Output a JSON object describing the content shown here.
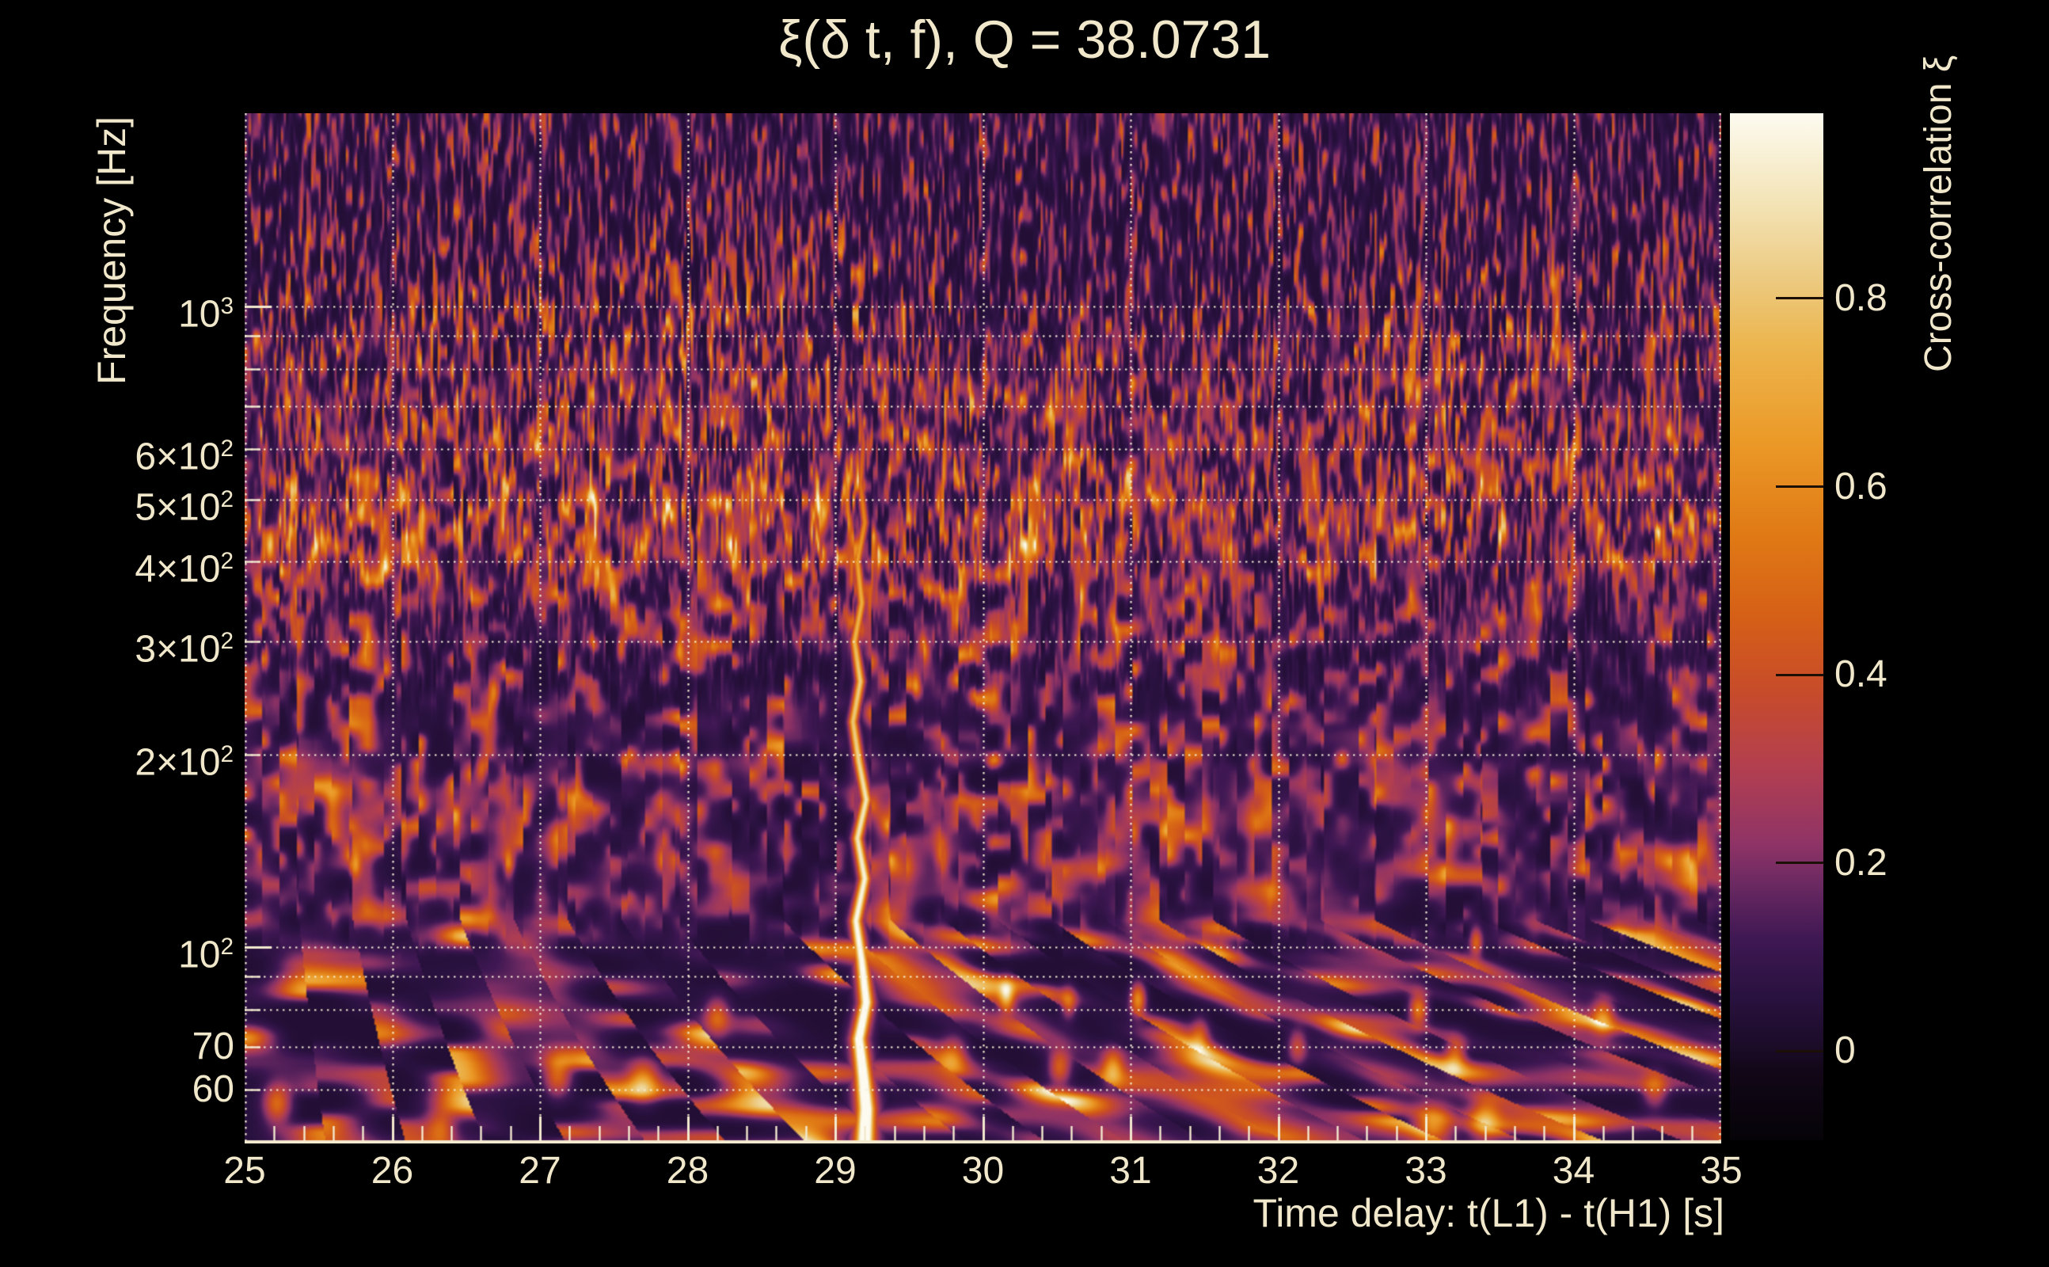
{
  "title": "ξ(δ t, f), Q = 38.0731",
  "q_value": 38.0731,
  "x_axis": {
    "label": "Time delay: t(L1) - t(H1) [s]",
    "min": 25,
    "max": 35,
    "minor_step": 0.2,
    "ticks": [
      25,
      26,
      27,
      28,
      29,
      30,
      31,
      32,
      33,
      34,
      35
    ]
  },
  "y_axis": {
    "label": "Frequency [Hz]",
    "scale": "log",
    "min": 50,
    "max": 2005,
    "ticks": [
      {
        "f": 1000,
        "label": "10^3"
      },
      {
        "f": 600,
        "label": "6×10^2"
      },
      {
        "f": 500,
        "label": "5×10^2"
      },
      {
        "f": 400,
        "label": "4×10^2"
      },
      {
        "f": 300,
        "label": "3×10^2"
      },
      {
        "f": 200,
        "label": "2×10^2"
      },
      {
        "f": 100,
        "label": "10^2"
      },
      {
        "f": 70,
        "label": "70"
      },
      {
        "f": 60,
        "label": "60"
      }
    ],
    "gridline_freqs": [
      60,
      70,
      80,
      90,
      100,
      200,
      300,
      400,
      500,
      600,
      700,
      800,
      900,
      1000
    ]
  },
  "colorbar": {
    "label": "Cross-correlation ξ",
    "vmin": -0.095,
    "vmax": 0.997,
    "ticks": [
      {
        "value": 0,
        "label": "0"
      },
      {
        "value": 0.2,
        "label": "0.2"
      },
      {
        "value": 0.4,
        "label": "0.4"
      },
      {
        "value": 0.6,
        "label": "0.6"
      },
      {
        "value": 0.8,
        "label": "0.8"
      }
    ]
  },
  "colors": {
    "background": "#000000",
    "text": "#f1e8cb",
    "grid": "#f6efd7",
    "axis": "#f2e9ce",
    "colorbar_tick": "#1c0f06",
    "colormap_stops": [
      [
        -0.095,
        "#060308"
      ],
      [
        -0.02,
        "#120718"
      ],
      [
        0.0,
        "#1a0b26"
      ],
      [
        0.06,
        "#2a1240"
      ],
      [
        0.12,
        "#3f1853"
      ],
      [
        0.18,
        "#6d2a62"
      ],
      [
        0.22,
        "#8f3366"
      ],
      [
        0.3,
        "#b23f50"
      ],
      [
        0.38,
        "#c74b2b"
      ],
      [
        0.46,
        "#d55f17"
      ],
      [
        0.55,
        "#e07a15"
      ],
      [
        0.65,
        "#eb9a28"
      ],
      [
        0.75,
        "#ecb54e"
      ],
      [
        0.82,
        "#ecca80"
      ],
      [
        0.9,
        "#f3e3b5"
      ],
      [
        0.997,
        "#fdfbf0"
      ]
    ]
  },
  "chart_data": {
    "type": "heatmap",
    "subtype": "q-transform cross-correlation spectrogram",
    "title": "ξ(δ t, f), Q = 38.0731",
    "xlabel": "Time delay: t(L1) - t(H1) [s]",
    "ylabel": "Frequency [Hz]",
    "zlabel": "Cross-correlation ξ",
    "x_range": [
      25,
      35
    ],
    "y_range_hz": [
      50,
      2005
    ],
    "z_range": [
      -0.095,
      0.997
    ],
    "grid": "dotted cream gridlines at integer seconds and log-decade frequencies",
    "noise_floor": 0.035,
    "chirp_track": [
      [
        50,
        29.2,
        0.99,
        0.055
      ],
      [
        56,
        29.21,
        0.97,
        0.05
      ],
      [
        63,
        29.19,
        0.93,
        0.046
      ],
      [
        72,
        29.16,
        0.88,
        0.042
      ],
      [
        82,
        29.21,
        0.85,
        0.04
      ],
      [
        95,
        29.18,
        0.8,
        0.037
      ],
      [
        110,
        29.14,
        0.76,
        0.034
      ],
      [
        128,
        29.2,
        0.74,
        0.032
      ],
      [
        148,
        29.15,
        0.7,
        0.03
      ],
      [
        170,
        29.21,
        0.7,
        0.029
      ],
      [
        195,
        29.16,
        0.66,
        0.028
      ],
      [
        225,
        29.12,
        0.62,
        0.027
      ],
      [
        260,
        29.17,
        0.64,
        0.026
      ],
      [
        300,
        29.13,
        0.58,
        0.025
      ],
      [
        345,
        29.18,
        0.56,
        0.024
      ],
      [
        400,
        29.15,
        0.52,
        0.023
      ],
      [
        460,
        29.2,
        0.46,
        0.022
      ],
      [
        530,
        29.17,
        0.4,
        0.021
      ],
      [
        610,
        29.19,
        0.33,
        0.02
      ],
      [
        700,
        29.16,
        0.24,
        0.019
      ],
      [
        810,
        29.18,
        0.16,
        0.018
      ]
    ],
    "hotspots": [
      [
        25.17,
        420,
        0.4,
        0.03,
        0.022
      ],
      [
        25.22,
        57,
        0.45,
        0.09,
        0.03
      ],
      [
        25.75,
        135,
        0.38,
        0.035,
        0.022
      ],
      [
        25.95,
        390,
        0.42,
        0.03,
        0.02
      ],
      [
        26.33,
        52,
        0.32,
        0.09,
        0.03
      ],
      [
        26.53,
        950,
        0.3,
        0.015,
        0.016
      ],
      [
        26.6,
        190,
        0.32,
        0.035,
        0.022
      ],
      [
        26.69,
        250,
        0.33,
        0.03,
        0.02
      ],
      [
        26.79,
        135,
        0.33,
        0.035,
        0.022
      ],
      [
        27.12,
        63,
        0.42,
        0.09,
        0.03
      ],
      [
        27.15,
        172,
        0.38,
        0.035,
        0.022
      ],
      [
        27.55,
        292,
        0.42,
        0.028,
        0.02
      ],
      [
        27.7,
        62,
        0.46,
        0.1,
        0.03
      ],
      [
        27.95,
        290,
        0.35,
        0.028,
        0.02
      ],
      [
        28.2,
        78,
        0.36,
        0.08,
        0.028
      ],
      [
        28.45,
        960,
        0.28,
        0.015,
        0.016
      ],
      [
        29.02,
        600,
        0.46,
        0.02,
        0.018
      ],
      [
        29.12,
        1130,
        0.34,
        0.014,
        0.016
      ],
      [
        29.55,
        255,
        0.4,
        0.028,
        0.02
      ],
      [
        29.8,
        68,
        0.36,
        0.09,
        0.028
      ],
      [
        30.16,
        84,
        0.52,
        0.05,
        0.024
      ],
      [
        30.52,
        65,
        0.4,
        0.07,
        0.026
      ],
      [
        30.58,
        82,
        0.33,
        0.05,
        0.024
      ],
      [
        30.88,
        65,
        0.46,
        0.07,
        0.026
      ],
      [
        31.05,
        83,
        0.55,
        0.05,
        0.024
      ],
      [
        31.15,
        540,
        0.36,
        0.022,
        0.018
      ],
      [
        31.47,
        73,
        0.3,
        0.06,
        0.026
      ],
      [
        32.13,
        70,
        0.3,
        0.06,
        0.026
      ],
      [
        32.5,
        650,
        0.3,
        0.018,
        0.018
      ],
      [
        32.95,
        80,
        0.5,
        0.06,
        0.025
      ],
      [
        33.05,
        53,
        0.58,
        0.13,
        0.03
      ],
      [
        33.2,
        68,
        0.42,
        0.07,
        0.026
      ],
      [
        33.34,
        102,
        0.4,
        0.04,
        0.022
      ],
      [
        33.4,
        54,
        0.45,
        0.1,
        0.03
      ],
      [
        33.76,
        600,
        0.34,
        0.018,
        0.018
      ],
      [
        34.0,
        595,
        0.3,
        0.018,
        0.018
      ],
      [
        34.2,
        78,
        0.42,
        0.07,
        0.027
      ],
      [
        34.55,
        60,
        0.32,
        0.08,
        0.028
      ],
      [
        34.65,
        635,
        0.28,
        0.018,
        0.018
      ],
      [
        34.9,
        430,
        0.32,
        0.022,
        0.018
      ]
    ],
    "noise_bands": [
      [
        50,
        1.35
      ],
      [
        54,
        1.15
      ],
      [
        58,
        1.3
      ],
      [
        62,
        1.1
      ],
      [
        66,
        1.3
      ],
      [
        72,
        1.2
      ],
      [
        78,
        1.3
      ],
      [
        84,
        1.15
      ],
      [
        90,
        1.2
      ],
      [
        96,
        1.0
      ],
      [
        104,
        1.05
      ],
      [
        115,
        0.8
      ],
      [
        130,
        0.72
      ],
      [
        150,
        0.78
      ],
      [
        175,
        0.85
      ],
      [
        200,
        0.9
      ],
      [
        240,
        0.95
      ],
      [
        280,
        0.92
      ],
      [
        330,
        0.85
      ],
      [
        400,
        0.9
      ],
      [
        470,
        1.0
      ],
      [
        540,
        0.92
      ],
      [
        620,
        0.88
      ],
      [
        700,
        0.95
      ],
      [
        800,
        1.0
      ],
      [
        900,
        1.05
      ],
      [
        980,
        1.12
      ],
      [
        1100,
        0.95
      ],
      [
        1300,
        0.85
      ],
      [
        1600,
        0.8
      ],
      [
        2005,
        0.8
      ]
    ]
  }
}
